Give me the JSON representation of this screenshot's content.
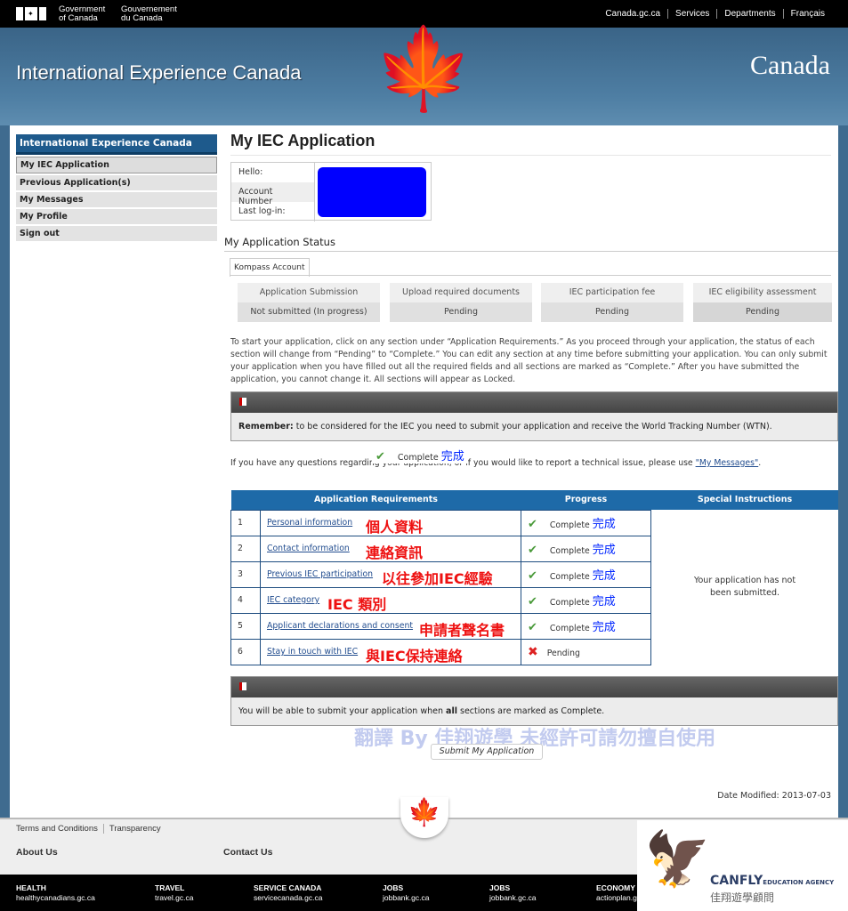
{
  "topbar": {
    "gov_en": [
      "Government",
      "of Canada"
    ],
    "gov_fr": [
      "Gouvernement",
      "du Canada"
    ],
    "links": [
      "Canada.gc.ca",
      "Services",
      "Departments",
      "Français"
    ]
  },
  "banner": {
    "title": "International Experience Canada",
    "wordmark": "Canada"
  },
  "sidebar": {
    "header": "International Experience Canada",
    "items": [
      "My IEC Application",
      "Previous Application(s)",
      "My Messages",
      "My Profile",
      "Sign out"
    ]
  },
  "main": {
    "title": "My IEC Application",
    "account": {
      "labels": [
        "Hello:",
        "Account Number",
        "Last log-in:"
      ]
    },
    "status_heading": "My Application Status",
    "tab": "Kompass Account",
    "status": [
      {
        "label": "Application Submission",
        "value": "Not submitted (In progress)"
      },
      {
        "label": "Upload required documents",
        "value": "Pending"
      },
      {
        "label": "IEC participation fee",
        "value": "Pending"
      },
      {
        "label": "IEC eligibility assessment",
        "value": "Pending"
      }
    ],
    "intro": "To start your application, click on any section under “Application Requirements.” As you proceed through your application, the status of each section will change from “Pending” to “Complete.” You can edit any section at any time before submitting your application. You can only submit your application when you have filled out all the required fields and all sections are marked as “Complete.” After you have submitted the application, you cannot change it. All sections will appear as Locked.",
    "remember_bold": "Remember:",
    "remember": " to be considered for the IEC you need to submit your application and receive the World Tracking Number (WTN).",
    "overlay_complete": "Complete",
    "overlay_zh": "完成",
    "questions": "If you have any questions regarding your application, or if you would like to report a technical issue, please use ",
    "messages_link": "\"My Messages\"",
    "questions_end": ".",
    "table": {
      "headers": [
        "Application Requirements",
        "Progress",
        "Special Instructions"
      ],
      "rows": [
        {
          "n": "1",
          "link": "Personal information",
          "zh": "個人資料",
          "status": "Complete",
          "zh_status": "完成",
          "ok": true
        },
        {
          "n": "2",
          "link": "Contact information",
          "zh": "連絡資訊",
          "status": "Complete",
          "zh_status": "完成",
          "ok": true
        },
        {
          "n": "3",
          "link": "Previous IEC participation",
          "zh": "以往參加IEC經驗",
          "status": "Complete",
          "zh_status": "完成",
          "ok": true
        },
        {
          "n": "4",
          "link": "IEC category",
          "zh": "IEC  類別",
          "status": "Complete",
          "zh_status": "完成",
          "ok": true
        },
        {
          "n": "5",
          "link": "Applicant declarations and consent",
          "zh": "申請者聲名書",
          "status": "Complete",
          "zh_status": "完成",
          "ok": true
        },
        {
          "n": "6",
          "link": "Stay in touch with IEC",
          "zh": "與IEC保持連絡",
          "status": "Pending",
          "zh_status": "",
          "ok": false
        }
      ],
      "special": "Your application has not been submitted."
    },
    "notice_pre": "You will be able to submit your application when ",
    "notice_bold": "all",
    "notice_post": " sections are marked as Complete.",
    "watermark": "翻譯 By 佳翔遊學 未經許可請勿擅自使用",
    "submit": "Submit My Application",
    "date_modified": "Date Modified: 2013-07-03"
  },
  "footer": {
    "links": [
      "Terms and Conditions",
      "Transparency"
    ],
    "headings": [
      "About Us",
      "Contact Us"
    ],
    "bottom": [
      {
        "h": "HEALTH",
        "u": "healthycanadians.gc.ca"
      },
      {
        "h": "TRAVEL",
        "u": "travel.gc.ca"
      },
      {
        "h": "SERVICE CANADA",
        "u": "servicecanada.gc.ca"
      },
      {
        "h": "JOBS",
        "u": "jobbank.gc.ca"
      },
      {
        "h": "JOBS",
        "u": "jobbank.gc.ca"
      },
      {
        "h": "ECONOMY",
        "u": "actionplan.gc.ca"
      }
    ]
  },
  "logo": {
    "name": "CANFLY",
    "sub": "EDUCATION AGENCY",
    "zh": "佳翔遊學顧問"
  },
  "colors": {
    "accent": "#1e6aa8",
    "banner": "#3f6b8f",
    "complete_zh": "#0026ff",
    "annotation": "#ee1111"
  }
}
